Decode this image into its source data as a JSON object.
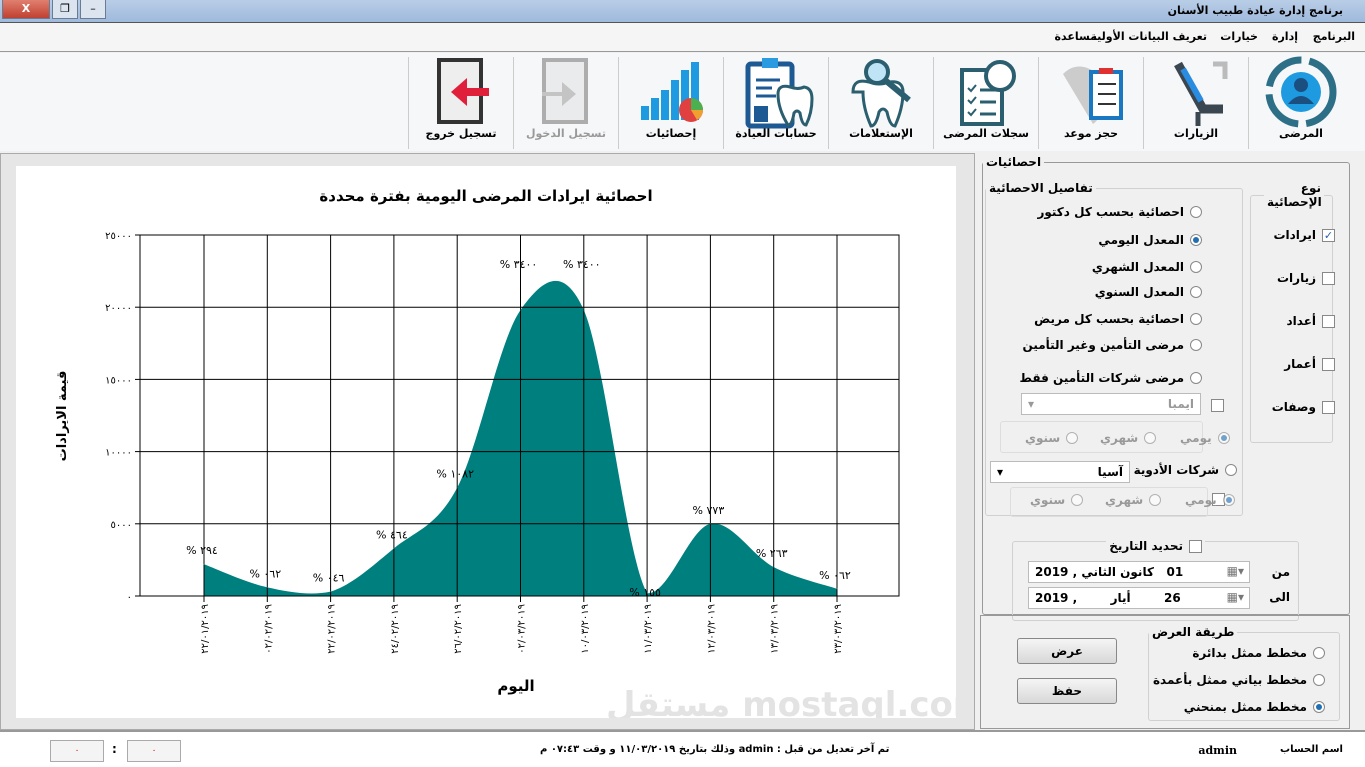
{
  "window": {
    "title": "برنامج إدارة عيادة طبيب الأسنان",
    "close": "X",
    "restore": "❐",
    "minimize": "–"
  },
  "menu": [
    "البرنامج",
    "إدارة",
    "خيارات",
    "تعريف البيانات الأولية",
    "مساعدة"
  ],
  "toolbar": [
    {
      "label": "المرضى",
      "icon": "patients-icon"
    },
    {
      "label": "الزيارات",
      "icon": "dental-chair-icon"
    },
    {
      "label": "حجز موعد",
      "icon": "appointment-icon"
    },
    {
      "label": "سجلات المرضى",
      "icon": "patient-records-icon"
    },
    {
      "label": "الإستعلامات",
      "icon": "tooth-search-icon"
    },
    {
      "label": "حسابات العيادة",
      "icon": "clinic-accounts-icon"
    },
    {
      "label": "إحصائيات",
      "icon": "statistics-icon"
    },
    {
      "label": "تسجيل الدخول",
      "icon": "login-icon"
    },
    {
      "label": "تسجيل خروج",
      "icon": "logout-icon"
    }
  ],
  "chart_data": {
    "type": "area",
    "title": "احصائية ايرادات المرضى اليومية بفترة محددة",
    "xlabel": "اليوم",
    "ylabel": "قيمة الايرادات",
    "ylim": [
      0,
      25000
    ],
    "yticks": [
      "٠",
      "٥٠٠٠",
      "١٠٠٠٠",
      "١٥٠٠٠",
      "٢٠٠٠٠",
      "٢٥٠٠٠"
    ],
    "ytick_values": [
      0,
      5000,
      10000,
      15000,
      20000,
      25000
    ],
    "categories": [
      "٢٢/٠١/٢٠١٩",
      "٠٢/٠٢/٢٠١٩",
      "٢٢/٠٢/٢٠١٩",
      "٢٤/٠٢/٢٠١٩",
      "٢٦/٠٢/٢٠١٩",
      "٠٢/٠٣/٢٠١٩",
      "١٠/٠٣/٢٠١٩",
      "١١/٠٣/٢٠١٩",
      "١٢/٠٣/٢٠١٩",
      "١٣/٠٣/٢٠١٩",
      "٢٣/٠٣/٢٠١٩"
    ],
    "values": [
      2200,
      600,
      300,
      3300,
      7500,
      19800,
      19800,
      200,
      5000,
      2000,
      500
    ],
    "data_labels": [
      "% ٢٩٤",
      "% ٠٦٢",
      "% ٠٤٦",
      "% ٤٦٤",
      "% ١٠٨٢",
      "% ٣٤٠٠",
      "% ٣٤٠٠",
      "% ١٥٥",
      "% ٧٧٣",
      "% ٢٦٣",
      "% ٠٦٢"
    ],
    "color": "#007f7f",
    "grid": true
  },
  "panel": {
    "title": "احصائيات",
    "type_group": "نوع الإحصائية",
    "types": [
      {
        "label": "ايرادات",
        "checked": true
      },
      {
        "label": "زيارات",
        "checked": false
      },
      {
        "label": "أعداد",
        "checked": false
      },
      {
        "label": "أعمار",
        "checked": false
      },
      {
        "label": "وصفات",
        "checked": false
      }
    ],
    "details_group": "تفاصيل الاحصائية",
    "details": [
      {
        "label": "احصائية بحسب كل دكتور",
        "on": false
      },
      {
        "label": "المعدل اليومي",
        "on": true
      },
      {
        "label": "المعدل الشهري",
        "on": false
      },
      {
        "label": "المعدل السنوي",
        "on": false
      },
      {
        "label": "احصائية بحسب كل مريض",
        "on": false
      },
      {
        "label": "مرضى التأمين وغير التأمين",
        "on": false
      },
      {
        "label": "مرضى شركات التأمين فقط",
        "on": false
      }
    ],
    "insurance_combo": "ايمبا",
    "period": [
      "يومي",
      "شهري",
      "سنوي"
    ],
    "pharma_label": "شركات الأدوية",
    "pharma_combo": "آسيا",
    "date_group": "تحديد التاريخ",
    "from_label": "من",
    "to_label": "الى",
    "from_date": "01   كانون الثاني , 2019",
    "to_date": "26        أيار        , 2019",
    "display_group": "طريقة العرض",
    "display": [
      {
        "label": "مخطط ممثل بدائرة",
        "on": false
      },
      {
        "label": "مخطط بياني ممثل بأعمدة",
        "on": false
      },
      {
        "label": "مخطط ممثل بمنحني",
        "on": true
      }
    ],
    "show_button": "عرض",
    "save_button": "حفظ"
  },
  "status": {
    "account_label": "اسم الحساب",
    "account": "admin",
    "last_edit": "تم آخر تعديل من قبل : admin وذلك بتاريخ ١١/٠٣/٢٠١٩ و وقت ٠٧:٤٣ م",
    "time_h": "٠",
    "time_m": "٠",
    "sep": ":"
  },
  "watermark": "مستقل mostaql.com"
}
